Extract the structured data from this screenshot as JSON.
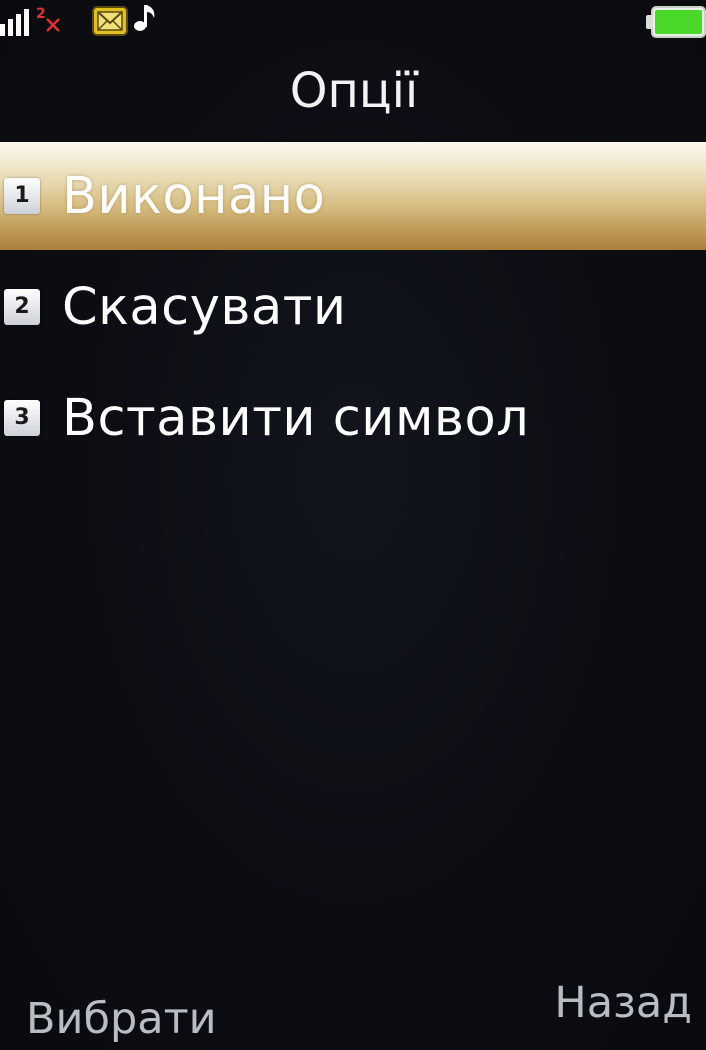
{
  "status_bar": {
    "signal_icon": "signal-bars-icon",
    "sim2_icon": "sim2-no-signal-icon",
    "sim2_label": "2",
    "message_icon": "envelope-icon",
    "ringtone_icon": "music-note-icon",
    "battery_icon": "battery-icon",
    "battery_level": 1.0,
    "colors": {
      "signal": "#ffffff",
      "sim2_x": "#e03030",
      "envelope": "#e0c020",
      "battery": "#4ad82a"
    }
  },
  "header": {
    "title": "Опції"
  },
  "menu": {
    "items": [
      {
        "number": "1",
        "label": "Виконано",
        "selected": true
      },
      {
        "number": "2",
        "label": "Скасувати",
        "selected": false
      },
      {
        "number": "3",
        "label": "Вставити символ",
        "selected": false
      }
    ]
  },
  "softkeys": {
    "left_label": "Вибрати",
    "right_label": "Назад"
  },
  "colors": {
    "background": "#0c0d13",
    "selection_top": "#fbf8ef",
    "selection_bottom": "#a97f3a",
    "softkey_text": "#b8bcc4"
  }
}
